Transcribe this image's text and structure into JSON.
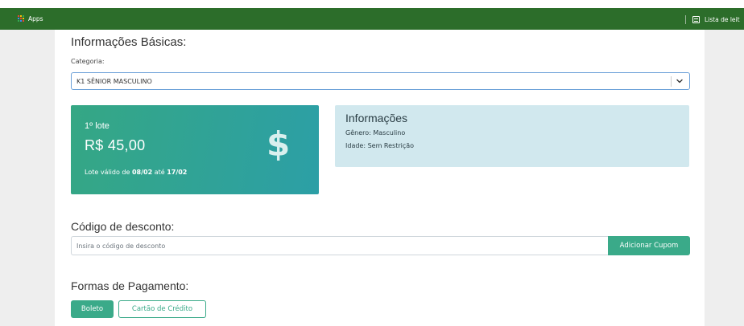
{
  "browser": {
    "apps_label": "Apps",
    "reading_list_label": "Lista de leit",
    "apps_grid_colors": [
      "#ea4335",
      "#fbbc05",
      "#34a853",
      "#4285f4",
      "#ea4335",
      "#fbbc05",
      "#34a853",
      "#4285f4",
      "#ea4335"
    ]
  },
  "basic": {
    "title": "Informações Básicas:",
    "category_label": "Categoria:",
    "category_value": "K1 SÊNIOR MASCULINO"
  },
  "lote": {
    "title": "1º lote",
    "price": "R$ 45,00",
    "valid_prefix": "Lote válido de ",
    "valid_from": "08/02",
    "valid_mid": " até ",
    "valid_to": "17/02",
    "icon_glyph": "$"
  },
  "info": {
    "title": "Informações",
    "genero_label": "Gênero:",
    "genero_value": " Masculino",
    "idade_label": "Idade:",
    "idade_value": " Sem Restrição"
  },
  "discount": {
    "title": "Código de desconto:",
    "placeholder": "Insira o código de desconto",
    "button": "Adicionar Cupom"
  },
  "payment": {
    "title": "Formas de Pagamento:",
    "options": [
      "Boleto",
      "Cartão de Crédito"
    ]
  },
  "colors": {
    "browser_bar": "#2c6d2a",
    "accent": "#3aaa89",
    "info_bg": "#d1e8ee"
  }
}
